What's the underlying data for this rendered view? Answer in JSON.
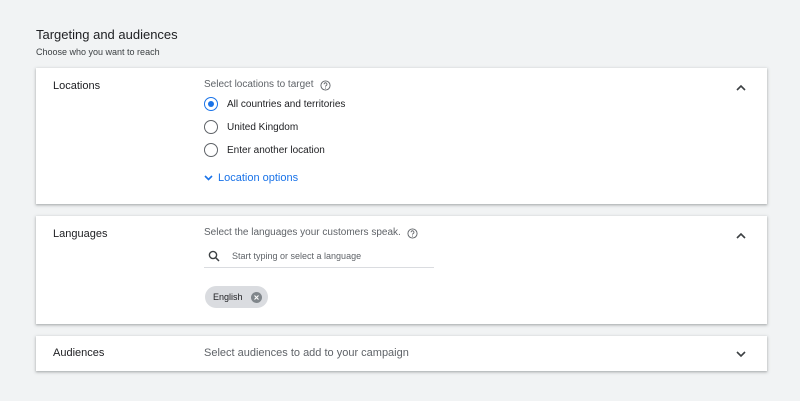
{
  "header": {
    "title": "Targeting and audiences",
    "subtitle": "Choose who you want to reach"
  },
  "locations": {
    "label": "Locations",
    "hint": "Select locations to target",
    "options": [
      {
        "label": "All countries and territories",
        "checked": true
      },
      {
        "label": "United Kingdom",
        "checked": false
      },
      {
        "label": "Enter another location",
        "checked": false
      }
    ],
    "more_options": "Location options"
  },
  "languages": {
    "label": "Languages",
    "hint": "Select the languages your customers speak.",
    "search_placeholder": "Start typing or select a language",
    "selected": [
      "English"
    ]
  },
  "audiences": {
    "label": "Audiences",
    "hint": "Select audiences to add to your campaign"
  },
  "colors": {
    "accent": "#1a73e8",
    "background": "#f1f3f4",
    "chip": "#dadce0"
  },
  "icons": [
    "help-icon",
    "chevron-up-icon",
    "chevron-down-icon",
    "search-icon",
    "close-icon"
  ]
}
